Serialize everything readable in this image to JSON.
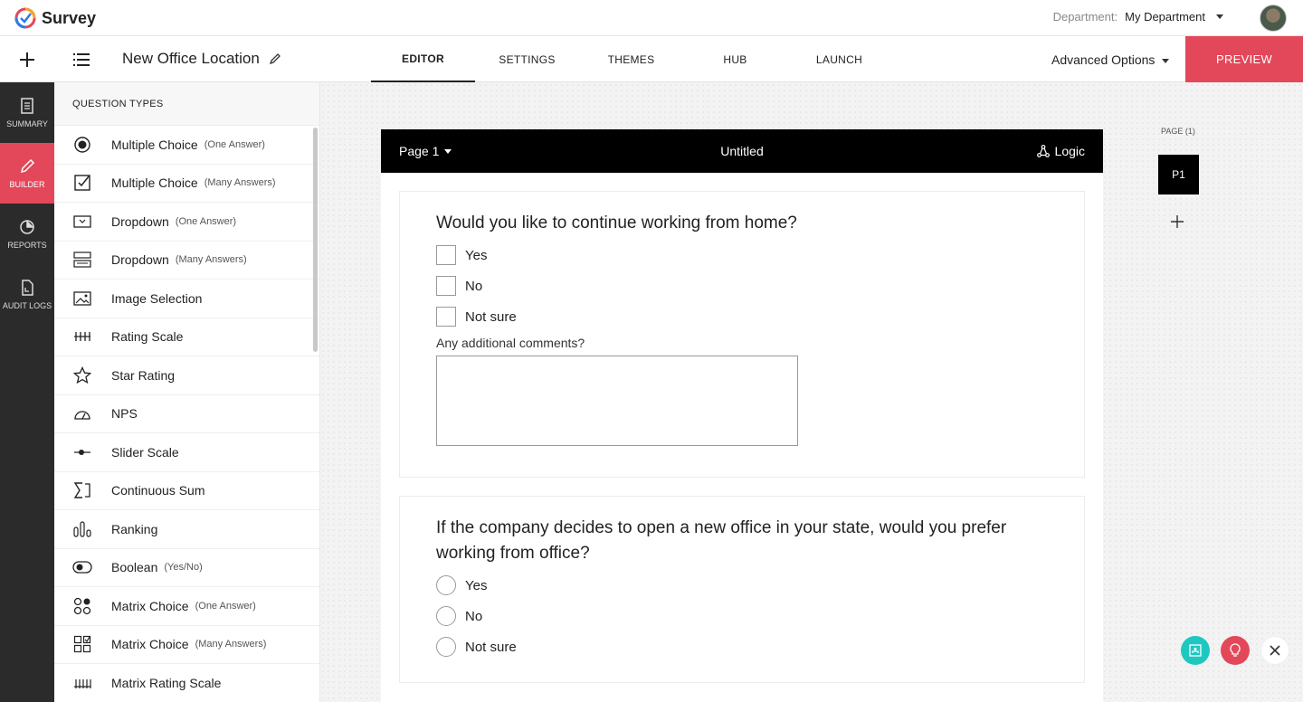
{
  "app": {
    "name": "Survey"
  },
  "header": {
    "department_label": "Department:",
    "department_value": "My Department"
  },
  "toolbar": {
    "survey_title": "New Office Location",
    "tabs": [
      {
        "label": "EDITOR",
        "active": true
      },
      {
        "label": "SETTINGS"
      },
      {
        "label": "THEMES"
      },
      {
        "label": "HUB"
      },
      {
        "label": "LAUNCH"
      }
    ],
    "advanced_options": "Advanced Options",
    "preview": "PREVIEW"
  },
  "leftnav": [
    {
      "label": "SUMMARY",
      "icon": "summary-icon"
    },
    {
      "label": "BUILDER",
      "icon": "pencil-icon",
      "active": true
    },
    {
      "label": "REPORTS",
      "icon": "pie-chart-icon"
    },
    {
      "label": "AUDIT LOGS",
      "icon": "audit-log-icon"
    }
  ],
  "question_types": {
    "heading": "QUESTION TYPES",
    "items": [
      {
        "label": "Multiple Choice",
        "sub": "(One Answer)",
        "icon": "radio-icon"
      },
      {
        "label": "Multiple Choice",
        "sub": "(Many Answers)",
        "icon": "checkbox-icon"
      },
      {
        "label": "Dropdown",
        "sub": "(One Answer)",
        "icon": "dropdown-icon"
      },
      {
        "label": "Dropdown",
        "sub": "(Many Answers)",
        "icon": "multi-dropdown-icon"
      },
      {
        "label": "Image Selection",
        "sub": "",
        "icon": "image-icon"
      },
      {
        "label": "Rating Scale",
        "sub": "",
        "icon": "rating-scale-icon"
      },
      {
        "label": "Star Rating",
        "sub": "",
        "icon": "star-icon"
      },
      {
        "label": "NPS",
        "sub": "",
        "icon": "gauge-icon"
      },
      {
        "label": "Slider Scale",
        "sub": "",
        "icon": "slider-icon"
      },
      {
        "label": "Continuous Sum",
        "sub": "",
        "icon": "sigma-icon"
      },
      {
        "label": "Ranking",
        "sub": "",
        "icon": "ranking-icon"
      },
      {
        "label": "Boolean",
        "sub": "(Yes/No)",
        "icon": "toggle-icon"
      },
      {
        "label": "Matrix Choice",
        "sub": "(One Answer)",
        "icon": "matrix-radio-icon"
      },
      {
        "label": "Matrix Choice",
        "sub": "(Many Answers)",
        "icon": "matrix-checkbox-icon"
      },
      {
        "label": "Matrix Rating Scale",
        "sub": "",
        "icon": "matrix-rating-icon"
      }
    ]
  },
  "page": {
    "name": "Page 1",
    "title": "Untitled",
    "logic": "Logic",
    "rail_label": "PAGE (1)",
    "rail_page": "P1"
  },
  "questions": [
    {
      "title": "Would you like to continue working from home?",
      "type": "checkbox",
      "options": [
        "Yes",
        "No",
        "Not sure"
      ],
      "comment_label": "Any additional comments?"
    },
    {
      "title": "If the company decides to open a new office in your state, would you prefer working from office?",
      "type": "radio",
      "options": [
        "Yes",
        "No",
        "Not sure"
      ]
    }
  ],
  "colors": {
    "accent": "#e2485a",
    "teal": "#1ec8c0",
    "dark": "#2b2b2b"
  }
}
